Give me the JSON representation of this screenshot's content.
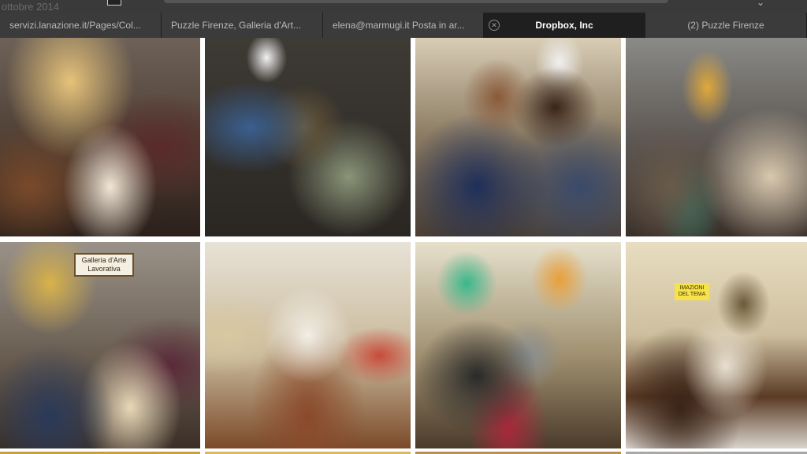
{
  "topbar": {
    "date_text": "ottobre 2014"
  },
  "tabs": [
    {
      "label": "servizi.lanazione.it/Pages/Col..."
    },
    {
      "label": "Puzzle Firenze, Galleria d'Art..."
    },
    {
      "label": "elena@marmugi.it Posta in ar..."
    },
    {
      "label": "Dropbox, Inc",
      "active": true
    },
    {
      "label": "(2) Puzzle Firenze"
    }
  ],
  "photos": [
    {
      "name": "photo-party-table",
      "sign": ""
    },
    {
      "name": "photo-conversation",
      "sign": ""
    },
    {
      "name": "photo-two-men-portrait",
      "sign": ""
    },
    {
      "name": "photo-gallery-hallway",
      "sign": ""
    },
    {
      "name": "photo-gallery-entrance",
      "sign": "Galleria d'Arte Lavorativa"
    },
    {
      "name": "photo-empty-chairs-room",
      "sign": ""
    },
    {
      "name": "photo-seated-audience",
      "sign": ""
    },
    {
      "name": "photo-books-table",
      "sign": "IMAZIONI DEL TEMA"
    }
  ],
  "colors": {
    "tabbar_bg": "#2c2c2c",
    "active_tab_bg": "#1f1f1f",
    "tab_text": "#b9b9b9"
  }
}
